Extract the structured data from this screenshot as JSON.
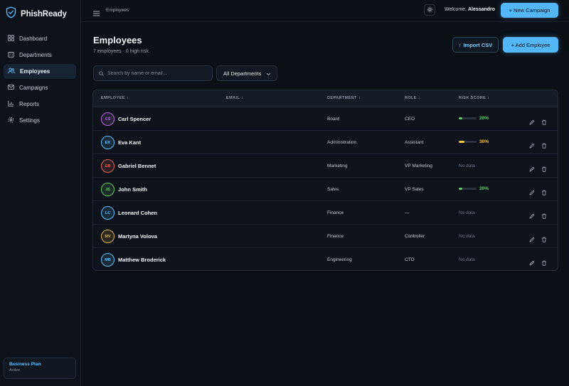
{
  "brand": {
    "name": "PhishReady"
  },
  "sidebar": {
    "items": [
      {
        "label": "Dashboard",
        "icon": "grid-icon"
      },
      {
        "label": "Departments",
        "icon": "building-icon"
      },
      {
        "label": "Employees",
        "icon": "users-icon",
        "active": true
      },
      {
        "label": "Campaigns",
        "icon": "mail-icon"
      },
      {
        "label": "Reports",
        "icon": "bar-chart-icon"
      },
      {
        "label": "Settings",
        "icon": "gear-icon"
      }
    ],
    "plan": {
      "name": "Business Plan",
      "status": "Active"
    }
  },
  "topbar": {
    "breadcrumb": "Employees",
    "welcome_prefix": "Welcome, ",
    "user_name": "Alessandro",
    "new_campaign_label": "+ New Campaign"
  },
  "page": {
    "title": "Employees",
    "subtitle": "7 employees · 0 high risk",
    "import_label": "Import CSV",
    "add_label": "+ Add Employee"
  },
  "filters": {
    "search_placeholder": "Search by name or email...",
    "department_selected": "All Departments"
  },
  "table": {
    "headers": {
      "employee": "EMPLOYEE ↕",
      "email": "EMAIL ↕",
      "department": "DEPARTMENT ↕",
      "role": "ROLE ↕",
      "risk": "RISK SCORE ↕"
    },
    "no_data_label": "No data",
    "rows": [
      {
        "initials": "CS",
        "name": "Carl Spencer",
        "email": "",
        "department": "Board",
        "role": "CEO",
        "risk": "20%",
        "risk_fraction": 0.2,
        "color": "#b26bd6"
      },
      {
        "initials": "EK",
        "name": "Eva Kant",
        "email": "",
        "department": "Administration",
        "role": "Assistant",
        "risk": "30%",
        "risk_fraction": 0.3,
        "color": "#5cc2ff"
      },
      {
        "initials": "GB",
        "name": "Gabriel Bennet",
        "email": "",
        "department": "Marketing",
        "role": "VP Marketing",
        "risk": null,
        "risk_fraction": null,
        "color": "#e0645a"
      },
      {
        "initials": "JS",
        "name": "John Smith",
        "email": "",
        "department": "Sales",
        "role": "VP Sales",
        "risk": "20%",
        "risk_fraction": 0.2,
        "color": "#5fce6a"
      },
      {
        "initials": "LC",
        "name": "Leonard Cohen",
        "email": "",
        "department": "Finance",
        "role": "—",
        "risk": null,
        "risk_fraction": null,
        "color": "#5cc2ff"
      },
      {
        "initials": "MV",
        "name": "Martyna Volova",
        "email": "",
        "department": "Finance",
        "role": "Controller",
        "risk": null,
        "risk_fraction": null,
        "color": "#e0b24a"
      },
      {
        "initials": "MB",
        "name": "Matthew Broderick",
        "email": "",
        "department": "Engineering",
        "role": "CTO",
        "risk": null,
        "risk_fraction": null,
        "color": "#5cc2ff"
      }
    ]
  },
  "colors": {
    "accent": "#53b7f7",
    "risk_low": "#5fce6a",
    "risk_medium": "#f5c542"
  }
}
